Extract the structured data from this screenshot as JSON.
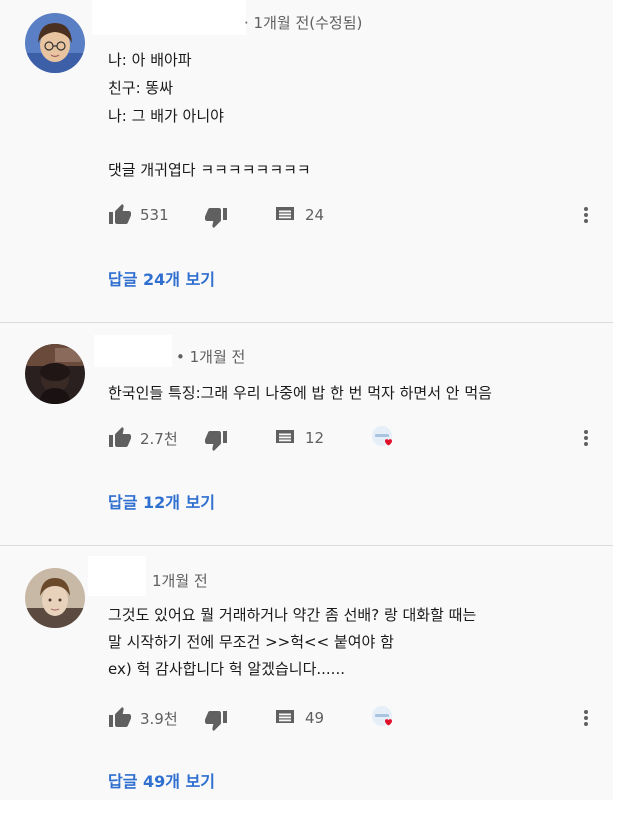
{
  "comments": [
    {
      "time": "· 1개월 전(수정됨)",
      "lines": [
        "나: 아 배아파",
        "친구: 똥싸",
        "나: 그 배가 아니야",
        "",
        "댓글 개귀엽다 ㅋㅋㅋㅋㅋㅋㅋㅋ"
      ],
      "likes": "531",
      "replies_count": "24",
      "replies_label": "답글 24개 보기",
      "creator_heart": false
    },
    {
      "time": "• 1개월 전",
      "lines": [
        "한국인들 특징:그래 우리 나중에 밥 한 번 먹자 하면서 안 먹음"
      ],
      "likes": "2.7천",
      "replies_count": "12",
      "replies_label": "답글 12개 보기",
      "creator_heart": true
    },
    {
      "time": "1개월 전",
      "lines": [
        "그것도 있어요 뭘 거래하거나 약간 좀 선배? 랑 대화할 때는",
        "말 시작하기 전에 무조건 >>헉<< 붙여야 함",
        "ex) 헉 감사합니다 헉 알겠습니다......"
      ],
      "likes": "3.9천",
      "replies_count": "49",
      "replies_label": "답글 49개 보기",
      "creator_heart": true
    }
  ],
  "icons": {
    "like": "thumbs-up-icon",
    "dislike": "thumbs-down-icon",
    "reply": "comment-icon",
    "more": "more-vertical-icon",
    "heart": "creator-heart-icon"
  },
  "colors": {
    "background": "#f9f9f9",
    "text": "#1a1a1a",
    "meta": "#606060",
    "icon": "#606060",
    "link": "#2f6fcf",
    "heart": "#e0102a"
  }
}
